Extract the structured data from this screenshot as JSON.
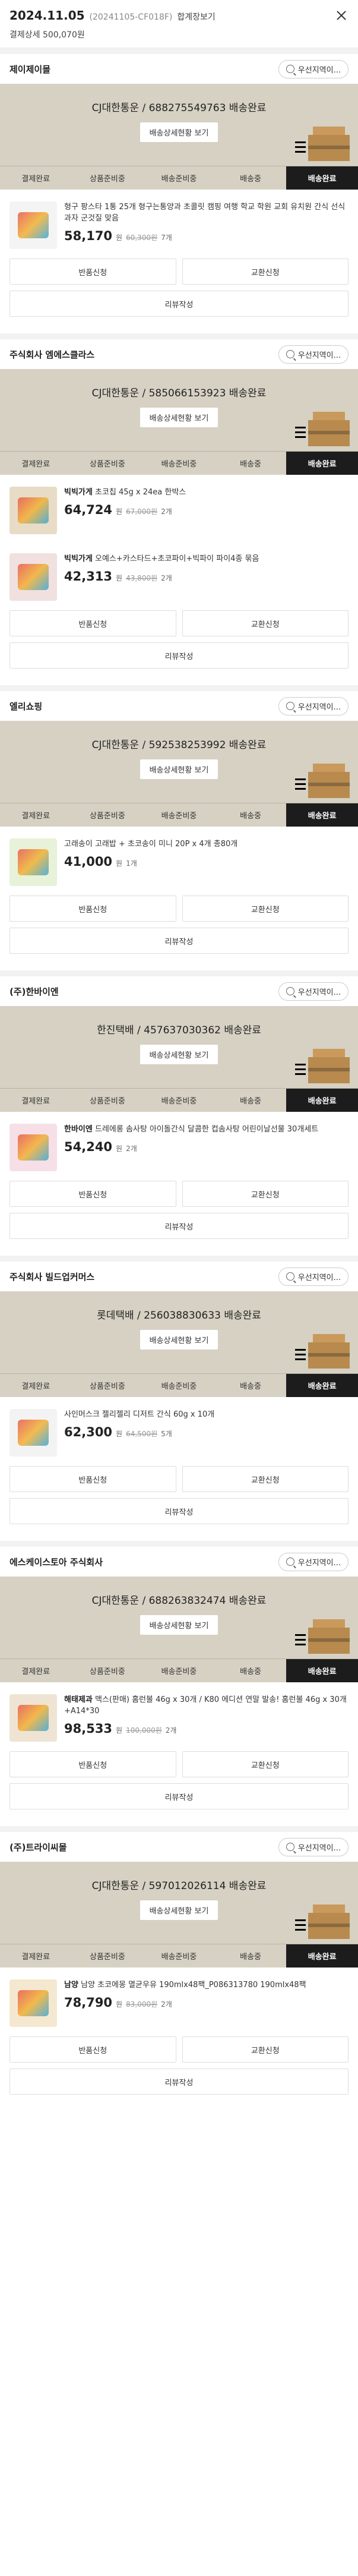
{
  "header": {
    "date": "2024.11.05",
    "order_no": "(20241105-CF018F)",
    "invoice": "합계장보기",
    "sub": "결제상세 500,070원"
  },
  "labels": {
    "chat": "우선지역이...",
    "track": "배송상세현황 보기",
    "unit": "원",
    "btn_return": "반품신청",
    "btn_exchange": "교환신청",
    "btn_review": "리뷰작성"
  },
  "steps": [
    "결제완료",
    "상품준비중",
    "배송준비중",
    "배송중",
    "배송완료"
  ],
  "sellers": [
    {
      "name": "제이제이몰",
      "delivery_title": "CJ대한통운 / 688275549763 배송완료",
      "items": [
        {
          "brand": "",
          "name": "형구 팡스타 1통 25개 형구는통양과 초콜릿 캠핑 여행 학교 학원 교회 유치원 간식 선식 과자 군것질 맞음",
          "price": "58,170",
          "orig": "60,300원",
          "qty": "7개",
          "thumb": "#f4f4f4"
        }
      ]
    },
    {
      "name": "주식회사 엠에스클라스",
      "delivery_title": "CJ대한통운 / 585066153923 배송완료",
      "items": [
        {
          "brand": "빅빅가게",
          "name": "초코칩 45g x 24ea 한박스",
          "price": "64,724",
          "orig": "67,000원",
          "qty": "2개",
          "thumb": "#e8dcc6"
        },
        {
          "brand": "빅빅가게",
          "name": "오예스+카스타드+초코파이+빅파이 파이4종 묶음",
          "price": "42,313",
          "orig": "43,800원",
          "qty": "2개",
          "thumb": "#f0e0e0"
        }
      ]
    },
    {
      "name": "엘리쇼핑",
      "delivery_title": "CJ대한통운 / 592538253992 배송완료",
      "items": [
        {
          "brand": "",
          "name": "고래송이 고래밥 + 초코송이 미니 20P x 4개 총80개",
          "price": "41,000",
          "orig": "",
          "qty": "1개",
          "thumb": "#e8f2d8"
        }
      ]
    },
    {
      "name": "(주)한바이엔",
      "delivery_title": "한진택배 / 457637030362 배송완료",
      "items": [
        {
          "brand": "한바이엔",
          "name": "드레에롱 솜사탕 아이돌간식 달콤한 컵솜사탕 어린이날선물 30개세트",
          "price": "54,240",
          "orig": "",
          "qty": "2개",
          "thumb": "#f6dfe6"
        }
      ]
    },
    {
      "name": "주식회사 빌드업커머스",
      "delivery_title": "롯데택배 / 256038830633 배송완료",
      "items": [
        {
          "brand": "",
          "name": "사인머스크 젤리젤리 디저트 간식 60g x 10개",
          "price": "62,300",
          "orig": "64,500원",
          "qty": "5개",
          "thumb": "#f3f3f3"
        }
      ]
    },
    {
      "name": "에스케이스토아 주식회사",
      "delivery_title": "CJ대한통운 / 688263832474 배송완료",
      "items": [
        {
          "brand": "해태제과",
          "name": "맥스(판매) 홈런볼 46g x 30개 / K80 에디션 연말 발송! 홈런볼 46g x 30개+A14*30",
          "price": "98,533",
          "orig": "100,000원",
          "qty": "2개",
          "thumb": "#efe4d4"
        }
      ]
    },
    {
      "name": "(주)트라이씨몰",
      "delivery_title": "CJ대한통운 / 597012026114 배송완료",
      "items": [
        {
          "brand": "남양",
          "name": "남양 초코에몽 멸균우유 190mlx48팩_P086313780 190mlx48팩",
          "price": "78,790",
          "orig": "83,000원",
          "qty": "2개",
          "thumb": "#f5e8d0"
        }
      ]
    }
  ]
}
